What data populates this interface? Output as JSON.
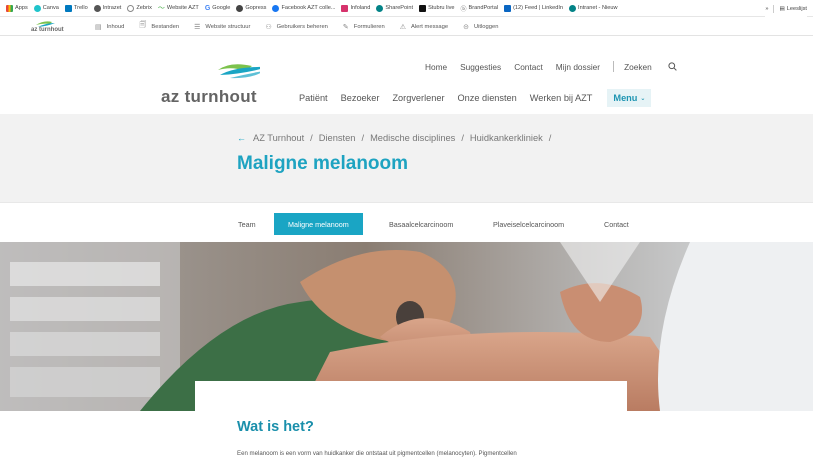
{
  "bookmarks": {
    "items": [
      {
        "label": "Apps",
        "icon": "apps-grid-icon",
        "color": "#e8453c"
      },
      {
        "label": "Canva",
        "icon": "canva-icon",
        "color": "#20c4cb"
      },
      {
        "label": "Trello",
        "icon": "trello-icon",
        "color": "#0079bf"
      },
      {
        "label": "Intrazet",
        "icon": "globe-icon",
        "color": "#555555"
      },
      {
        "label": "Zebrix",
        "icon": "zebrix-icon",
        "color": "#888888"
      },
      {
        "label": "Website AZT",
        "icon": "azt-wave-icon",
        "color": "#4cae4c"
      },
      {
        "label": "Google",
        "icon": "google-icon",
        "color": "#4285f4"
      },
      {
        "label": "Gopress",
        "icon": "gopress-icon",
        "color": "#444444"
      },
      {
        "label": "Facebook AZT colle...",
        "icon": "facebook-icon",
        "color": "#1877f2"
      },
      {
        "label": "Infoland",
        "icon": "infoland-icon",
        "color": "#d6336c"
      },
      {
        "label": "SharePoint",
        "icon": "sharepoint-icon",
        "color": "#038387"
      },
      {
        "label": "Stubru live",
        "icon": "stubru-icon",
        "color": "#111111"
      },
      {
        "label": "BrandPortal",
        "icon": "brandportal-icon",
        "color": "#666666"
      },
      {
        "label": "(12) Feed | LinkedIn",
        "icon": "linkedin-icon",
        "color": "#0a66c2"
      },
      {
        "label": "Intranet - Nieuw",
        "icon": "intranet-icon",
        "color": "#038387"
      }
    ],
    "more": "»",
    "reading_list": "Leeslijst"
  },
  "admin_bar": {
    "logo_text": "az turnhout",
    "items": [
      {
        "label": "Inhoud",
        "icon": "content-icon",
        "glyph": "▤"
      },
      {
        "label": "Bestanden",
        "icon": "files-icon",
        "glyph": "🗐"
      },
      {
        "label": "Website structuur",
        "icon": "structure-icon",
        "glyph": "☰"
      },
      {
        "label": "Gebruikers beheren",
        "icon": "users-icon",
        "glyph": "⚇"
      },
      {
        "label": "Formulieren",
        "icon": "forms-icon",
        "glyph": "✎"
      },
      {
        "label": "Alert message",
        "icon": "alert-icon",
        "glyph": "⚠"
      },
      {
        "label": "Uitloggen",
        "icon": "logout-icon",
        "glyph": "⊝"
      }
    ]
  },
  "header": {
    "top_links": [
      "Home",
      "Suggesties",
      "Contact",
      "Mijn dossier"
    ],
    "search_label": "Zoeken",
    "logo_text": "az turnhout",
    "main_nav": [
      "Patiënt",
      "Bezoeker",
      "Zorgverlener",
      "Onze diensten",
      "Werken bij AZT"
    ],
    "menu_label": "Menu"
  },
  "hero": {
    "breadcrumb": [
      "AZ Turnhout",
      "Diensten",
      "Medische disciplines",
      "Huidkankerkliniek"
    ],
    "title": "Maligne melanoom"
  },
  "subnav": {
    "tabs": [
      "Team",
      "Maligne melanoom",
      "Basaalcelcarcinoom",
      "Plaveiselcelcarcinoom",
      "Contact"
    ],
    "active_index": 1
  },
  "content": {
    "section_title": "Wat is het?",
    "body": "Een melanoom is een vorm van huidkanker die ontstaat uit pigmentcellen (melanocyten). Pigmentcellen"
  },
  "colors": {
    "brand_teal": "#1aa5c4",
    "brand_green": "#7cc24c",
    "hero_bg": "#f2f2f2"
  }
}
